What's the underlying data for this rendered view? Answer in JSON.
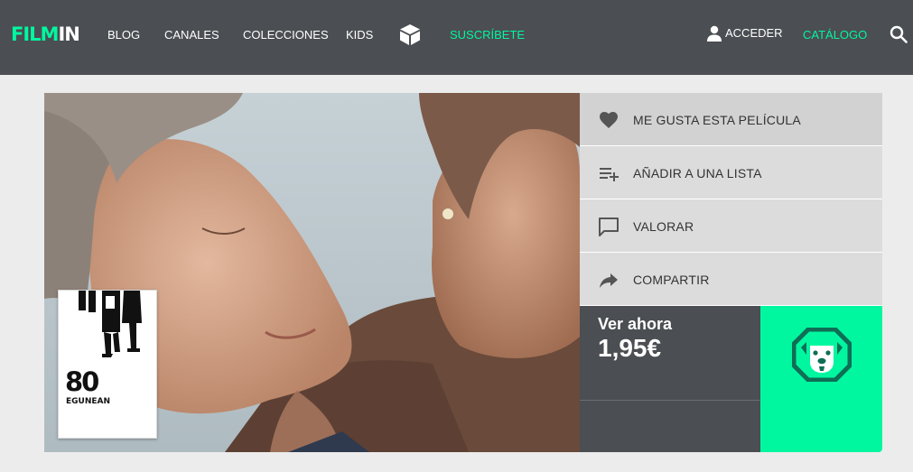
{
  "nav": {
    "logo_a": "FILM",
    "logo_b": "IN",
    "items": [
      {
        "label": "BLOG"
      },
      {
        "label": "CANALES"
      },
      {
        "label": "COLECCIONES"
      },
      {
        "label": "KIDS"
      }
    ],
    "subscribe": "SUSCRÍBETE",
    "login": "ACCEDER",
    "catalog": "CATÁLOGO",
    "icons": [
      "cube-icon",
      "user-icon",
      "search-icon"
    ]
  },
  "movie": {
    "poster_number": "80",
    "poster_word": "EGUNEAN"
  },
  "actions": [
    {
      "label": "ME GUSTA ESTA PELÍCULA",
      "icon": "heart-icon"
    },
    {
      "label": "AÑADIR A UNA LISTA",
      "icon": "playlist-add-icon"
    },
    {
      "label": "VALORAR",
      "icon": "comment-icon"
    },
    {
      "label": "COMPARTIR",
      "icon": "share-icon"
    }
  ],
  "purchase": {
    "watch_label": "Ver ahora",
    "price": "1,95€"
  },
  "colors": {
    "accent": "#00f7a0",
    "nav_bg": "#4b4e52",
    "page_bg": "#ececec",
    "action_bg": "#dcdcdc",
    "text_dark": "#333333"
  }
}
